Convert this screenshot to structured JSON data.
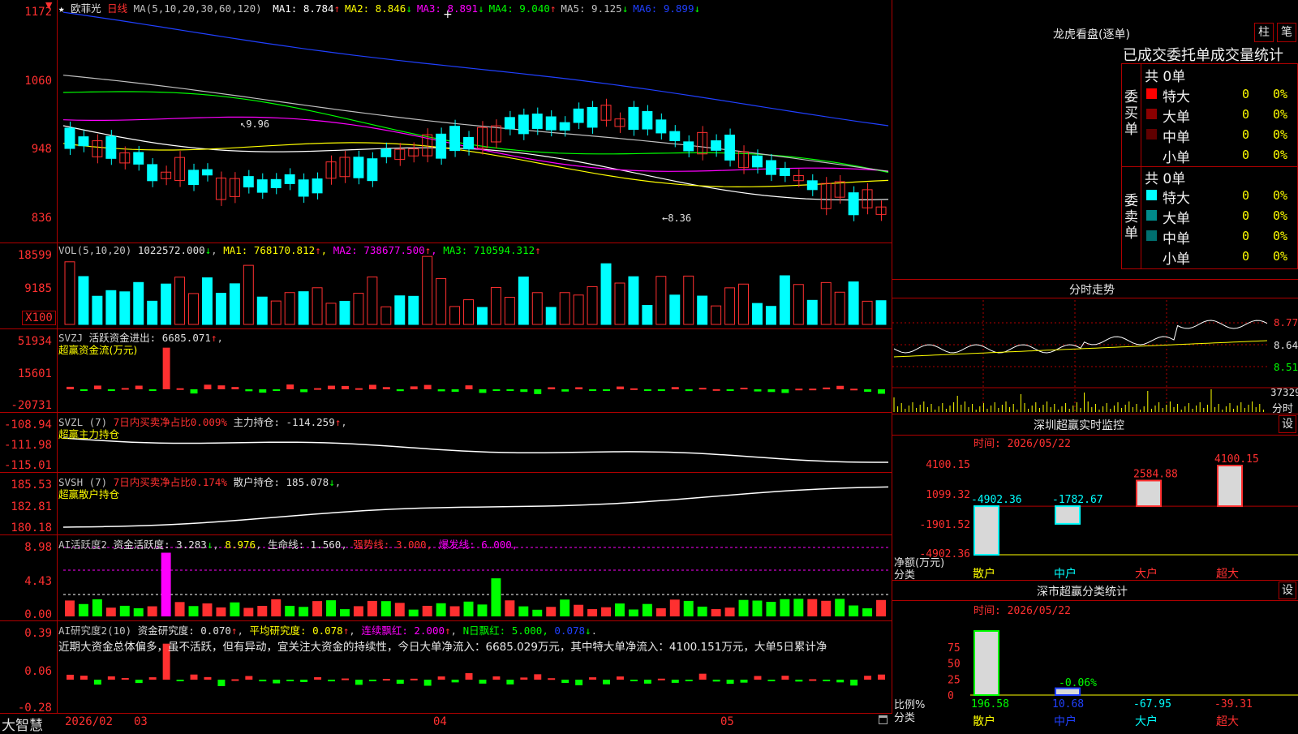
{
  "main_chart": {
    "stock_name": "欧菲光",
    "period": "日线",
    "ma_label": "MA(5,10,20,30,60,120)",
    "ma": [
      {
        "name": "MA1",
        "value": "8.784",
        "arrow": "↑",
        "color": "#ffffff"
      },
      {
        "name": "MA2",
        "value": "8.846",
        "arrow": "↓",
        "color": "#ffff00"
      },
      {
        "name": "MA3",
        "value": "8.891",
        "arrow": "↓",
        "color": "#ff00ff"
      },
      {
        "name": "MA4",
        "value": "9.040",
        "arrow": "↑",
        "color": "#00ff00"
      },
      {
        "name": "MA5",
        "value": "9.125",
        "arrow": "↓",
        "color": "#c0c0c0"
      },
      {
        "name": "MA6",
        "value": "9.899",
        "arrow": "↓",
        "color": "#2040ff"
      }
    ],
    "y_ticks": [
      "1172",
      "1060",
      "948",
      "836"
    ],
    "high_label": "9.96",
    "low_label": "8.36"
  },
  "volume": {
    "label": "VOL(5,10,20)",
    "value": "1022572.000",
    "value_arrow": "↓",
    "ma1": "768170.812",
    "ma1_arrow": "↑",
    "ma2": "738677.500",
    "ma2_arrow": "↑",
    "ma3": "710594.312",
    "ma3_arrow": "↑",
    "y_ticks": [
      "18599",
      "9185"
    ],
    "unit": "X100"
  },
  "svzj": {
    "name": "SVZJ",
    "label": "活跃资金进出:",
    "value": "6685.071",
    "arrow": "↑",
    "subtitle": "超赢资金流(万元)",
    "y_ticks": [
      "51934",
      "15601",
      "-20731"
    ]
  },
  "svzl": {
    "name": "SVZL (7)",
    "desc": "7日内买卖净占比0.009%",
    "label": "主力持仓:",
    "value": "-114.259",
    "arrow": "↑",
    "subtitle": "超赢主力持仓",
    "y_ticks": [
      "-108.94",
      "-111.98",
      "-115.01"
    ]
  },
  "svsh": {
    "name": "SVSH (7)",
    "desc": "7日内买卖净占比0.174%",
    "label": "散户持仓:",
    "value": "185.078",
    "arrow": "↓",
    "subtitle": "超赢散户持仓",
    "y_ticks": [
      "185.53",
      "182.81",
      "180.18"
    ]
  },
  "ai_active": {
    "name": "AI活跃度2",
    "label": "资金活跃度:",
    "value": "3.283",
    "arrow": "↓",
    "v2": "8.976",
    "life_label": "生命线:",
    "life_value": "1.560",
    "strong_label": "强势线:",
    "strong_value": "3.000",
    "burst_label": "爆发线:",
    "burst_value": "6.000",
    "y_ticks": [
      "8.98",
      "4.43",
      "0.00"
    ]
  },
  "ai_research": {
    "name": "AI研究度2(10)",
    "label": "资金研究度:",
    "value": "0.070",
    "arrow": "↑",
    "avg_label": "平均研究度:",
    "avg_value": "0.078",
    "avg_arrow": "↑",
    "cont_label": "连续飘红:",
    "cont_value": "2.000",
    "cont_arrow": "↑",
    "n_label": "N日飘红:",
    "n_value": "5.000",
    "last_value": "0.078",
    "last_arrow": "↓",
    "commentary": "近期大资金总体偏多，虽不活跃，但有异动，宜关注大资金的持续性，今日大单净流入：6685.029万元，其中特大单净流入：4100.151万元，大单5日累计净",
    "y_ticks": [
      "0.39",
      "0.06",
      "-0.28"
    ]
  },
  "x_axis": {
    "logo": "大智慧",
    "labels": [
      {
        "text": "2026/02"
      },
      {
        "text": "03"
      },
      {
        "text": "04"
      },
      {
        "text": "05"
      }
    ]
  },
  "order_panel": {
    "title": "龙虎看盘(逐单)",
    "btn1": "柱",
    "btn2": "笔",
    "section_title": "已成交委托单成交量统计",
    "buy_label": "委买单",
    "sell_label": "委卖单",
    "buy_total": "共 0单",
    "sell_total": "共 0单",
    "buy_rows": [
      {
        "label": "特大",
        "value": "0",
        "pct": "0%",
        "color": "#ff0000"
      },
      {
        "label": "大单",
        "value": "0",
        "pct": "0%",
        "color": "#8b0000"
      },
      {
        "label": "中单",
        "value": "0",
        "pct": "0%",
        "color": "#600000"
      },
      {
        "label": "小单",
        "value": "0",
        "pct": "0%",
        "color": ""
      }
    ],
    "sell_rows": [
      {
        "label": "特大",
        "value": "0",
        "pct": "0%",
        "color": "#00ffff"
      },
      {
        "label": "大单",
        "value": "0",
        "pct": "0%",
        "color": "#008b8b"
      },
      {
        "label": "中单",
        "value": "0",
        "pct": "0%",
        "color": "#007070"
      },
      {
        "label": "小单",
        "value": "0",
        "pct": "0%",
        "color": ""
      }
    ]
  },
  "intraday": {
    "title": "分时走势",
    "prices": [
      "8.77",
      "8.64",
      "8.51"
    ],
    "volume": "37329",
    "unit": "分时"
  },
  "sz_monitor": {
    "title": "深圳超赢实时监控",
    "btn": "设",
    "time": "时间: 2026/05/22",
    "y_ticks": [
      "4100.15",
      "1099.32",
      "-1901.52",
      "-4902.36"
    ],
    "ylabel": "净额(万元)",
    "xlabel": "分类",
    "chart_data": {
      "type": "bar",
      "categories": [
        "散户",
        "中户",
        "大户",
        "超大"
      ],
      "values": [
        -4902.36,
        -1782.67,
        2584.88,
        4100.15
      ],
      "value_labels": [
        "-4902.36",
        "-1782.67",
        "2584.88",
        "4100.15"
      ],
      "ylim": [
        -4902.36,
        4100.15
      ]
    }
  },
  "sz_stats": {
    "title": "深市超赢分类统计",
    "btn": "设",
    "time": "时间: 2026/05/22",
    "ylabel": "比例%",
    "xlabel": "分类",
    "y_ticks": [
      "75",
      "50",
      "25",
      "0"
    ],
    "chart_data": {
      "type": "bar",
      "categories": [
        "散户",
        "中户",
        "大户",
        "超大"
      ],
      "values": [
        196.58,
        10.68,
        -67.95,
        -39.31
      ],
      "value_labels": [
        "196.58",
        "10.68",
        "-67.95",
        "-39.31"
      ],
      "extra_label": "-0.06%",
      "ylim": [
        0,
        100
      ]
    }
  }
}
